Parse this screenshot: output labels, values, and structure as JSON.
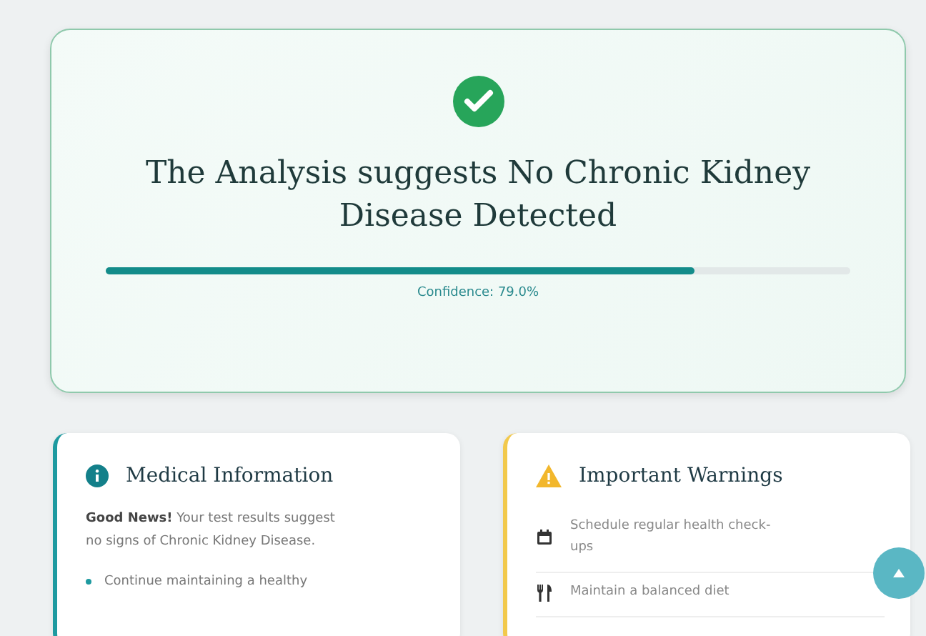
{
  "result": {
    "title": "The Analysis suggests No Chronic Kidney Disease Detected",
    "confidence": {
      "level": 0.79,
      "label": "Confidence: 79.0%"
    }
  },
  "medical_info": {
    "title": "Medical Information",
    "lead": "Good News!",
    "text": "Your test results suggest no signs of Chronic Kidney Disease.",
    "bullets": [
      "Continue maintaining a healthy"
    ]
  },
  "warnings": {
    "title": "Important Warnings",
    "items": [
      {
        "kind": "calendar",
        "text": "Schedule regular health check-ups"
      },
      {
        "kind": "utensils",
        "text": "Maintain a balanced diet"
      }
    ]
  }
}
